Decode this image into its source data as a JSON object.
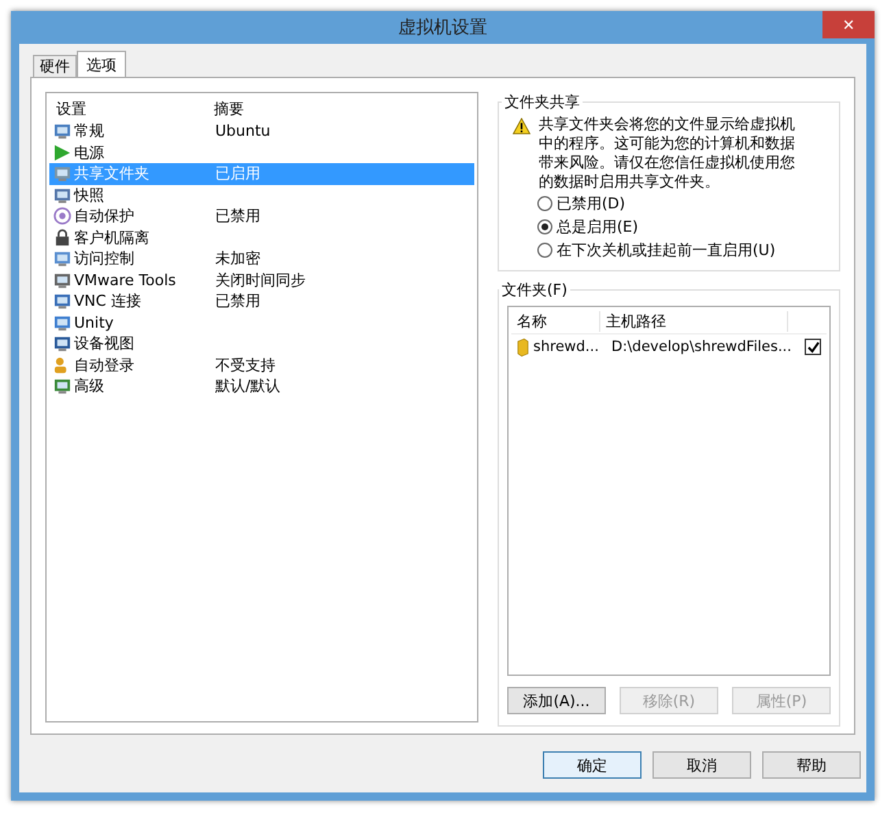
{
  "window": {
    "title": "虚拟机设置",
    "close": "✕"
  },
  "tabs": [
    {
      "label": "硬件",
      "selected": false
    },
    {
      "label": "选项",
      "selected": true
    }
  ],
  "settings": {
    "columns": [
      "设置",
      "摘要"
    ],
    "rows": [
      {
        "name": "常规",
        "summary": "Ubuntu",
        "selected": false
      },
      {
        "name": "电源",
        "selected": false
      },
      {
        "name": "共享文件夹",
        "summary": "已启用",
        "selected": true
      },
      {
        "name": "快照",
        "selected": false
      },
      {
        "name": "自动保护",
        "summary": "已禁用",
        "selected": false
      },
      {
        "name": "客户机隔离",
        "selected": false
      },
      {
        "name": "访问控制",
        "summary": "未加密",
        "selected": false
      },
      {
        "name": "VMware Tools",
        "summary": "关闭时间同步",
        "selected": false
      },
      {
        "name": "VNC 连接",
        "summary": "已禁用",
        "selected": false
      },
      {
        "name": "Unity",
        "selected": false
      },
      {
        "name": "设备视图",
        "selected": false
      },
      {
        "name": "自动登录",
        "summary": "不受支持",
        "selected": false
      },
      {
        "name": "高级",
        "summary": "默认/默认",
        "selected": false
      }
    ]
  },
  "folder_sharing": {
    "title": "文件夹共享",
    "warning": "共享文件夹会将您的文件显示给虚拟机中的程序。这可能为您的计算机和数据带来风险。请仅在您信任虚拟机使用您的数据时启用共享文件夹。",
    "options": [
      {
        "label": "已禁用(D)",
        "selected": false
      },
      {
        "label": "总是启用(E)",
        "selected": true
      },
      {
        "label": "在下次关机或挂起前一直启用(U)",
        "selected": false
      }
    ]
  },
  "folders": {
    "title": "文件夹(F)",
    "columns": [
      "名称",
      "主机路径"
    ],
    "rows": [
      {
        "name": "shrewd...",
        "path": "D:\\develop\\shrewdFiles...",
        "checked": true
      }
    ],
    "buttons": [
      {
        "label": "添加(A)...",
        "disabled": false
      },
      {
        "label": "移除(R)",
        "disabled": true
      },
      {
        "label": "属性(P)",
        "disabled": true
      }
    ]
  },
  "buttons": [
    "确定",
    "取消",
    "帮助"
  ]
}
